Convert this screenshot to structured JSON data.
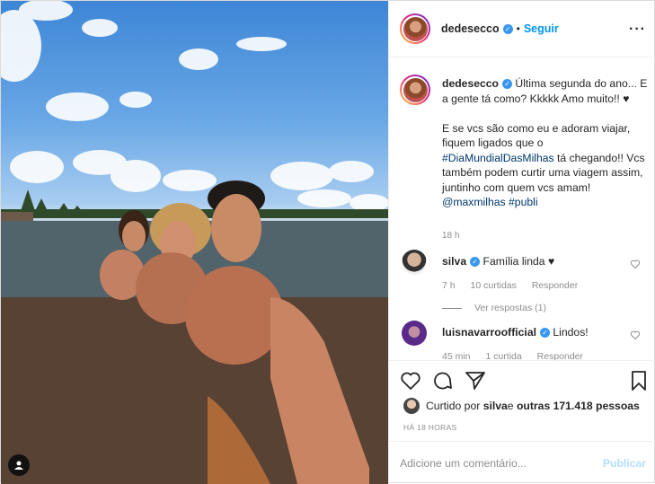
{
  "colors": {
    "link": "#00376b",
    "follow": "#0095f6",
    "verified": "#3897f0",
    "muted": "#8e8e8e",
    "publish_disabled": "#b2dffc"
  },
  "header": {
    "username": "dedesecco",
    "separator": "•",
    "follow_label": "Seguir",
    "more_icon": "more-horizontal-icon"
  },
  "caption": {
    "username": "dedesecco",
    "text_1": "Última segunda do ano... E a gente tá como? Kkkkk Amo muito!! ♥",
    "text_2a": "E se vcs são como eu e adoram viajar, fiquem ligados que o ",
    "hashtag_1": "#DiaMundialDasMilhas",
    "text_2b": " tá chegando!! Vcs também podem curtir uma viagem assim, juntinho com quem vcs amam! ",
    "mention": "@maxmilhas",
    "space": " ",
    "hashtag_2": "#publi",
    "time": "18 h"
  },
  "comments": [
    {
      "username": "silva",
      "text": "Família linda ♥",
      "time": "7 h",
      "likes": "10 curtidas",
      "reply": "Responder",
      "view_replies": "Ver respostas (1)"
    },
    {
      "username": "luisnavarroofficial",
      "text": "Lindos!",
      "time": "45 min",
      "likes": "1 curtida",
      "reply": "Responder"
    }
  ],
  "likes": {
    "prefix": "Curtido por ",
    "user": "silva",
    "middle": " e ",
    "others": "outras 171.418 pessoas"
  },
  "posted_ago": "HÁ 18 HORAS",
  "add_comment": {
    "placeholder": "Adicione um comentário...",
    "publish_label": "Publicar"
  }
}
